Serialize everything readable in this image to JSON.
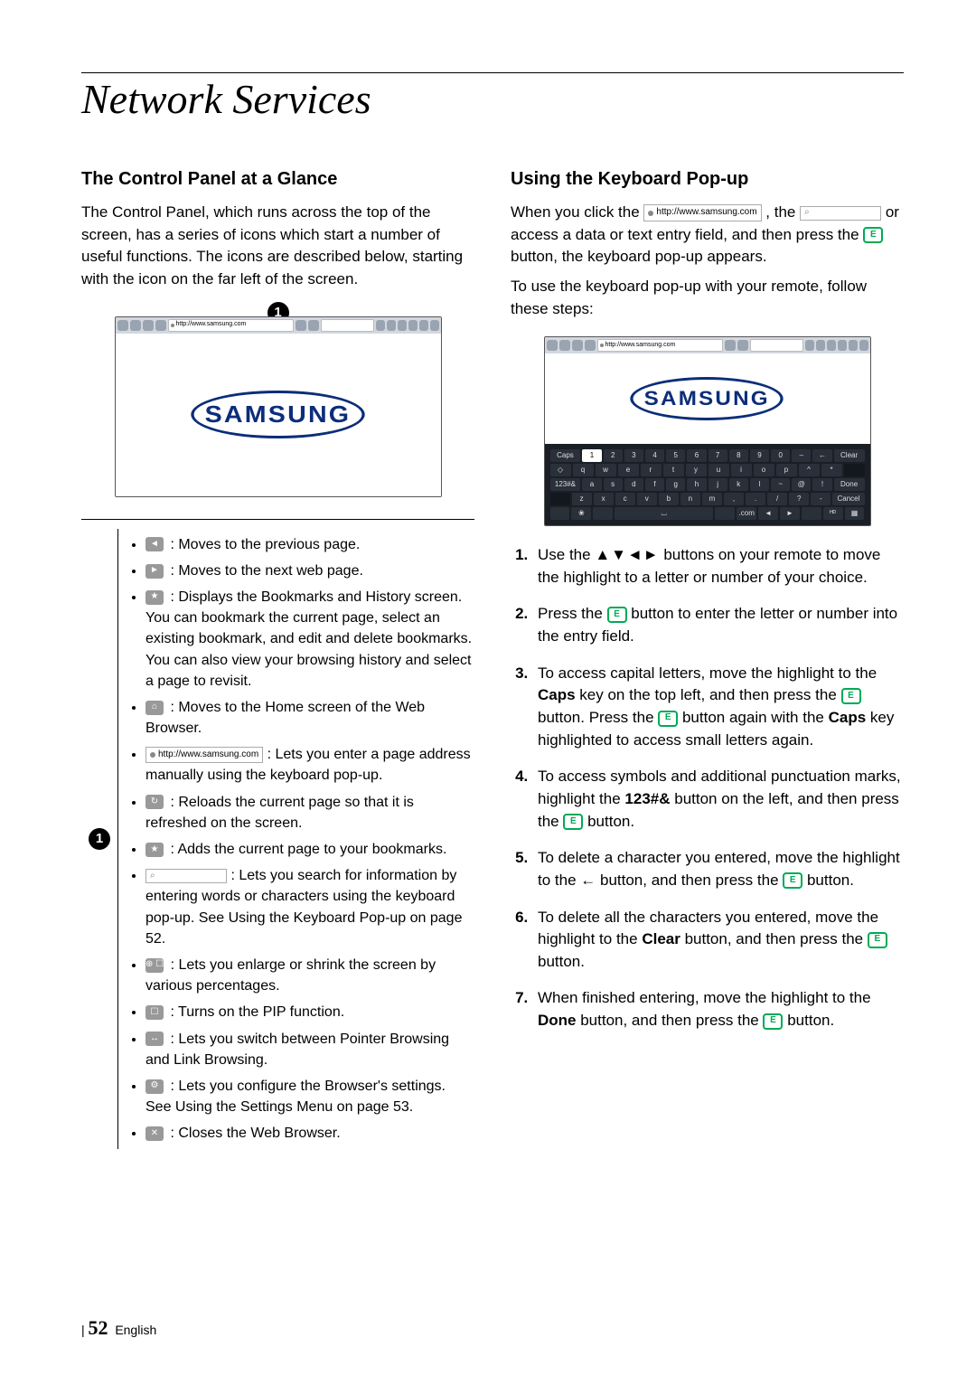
{
  "title": "Network Services",
  "left": {
    "heading": "The Control Panel at a Glance",
    "intro": "The Control Panel, which runs across the top of the screen, has a series of icons which start a number of useful functions. The icons are described below, starting with the icon on the far left of the screen.",
    "figure_url": "http://www.samsung.com",
    "figure_logo": "SAMSUNG",
    "callout_number": "1",
    "items": [
      {
        "icon": "back-icon",
        "glyph": "◄",
        "text": " : Moves to the previous page."
      },
      {
        "icon": "forward-icon",
        "glyph": "►",
        "text": " : Moves to the next web page."
      },
      {
        "icon": "bookmarks-icon",
        "glyph": "★",
        "text": " : Displays the Bookmarks and History screen. You can bookmark the current page, select an existing bookmark, and edit and delete bookmarks. You can also view your browsing history and select a page to revisit."
      },
      {
        "icon": "home-icon",
        "glyph": "⌂",
        "text": " : Moves to the Home screen of the Web Browser."
      },
      {
        "icon": "url-input-icon",
        "url": "http://www.samsung.com",
        "text": " : Lets you enter a page address manually using the keyboard pop-up."
      },
      {
        "icon": "reload-icon",
        "glyph": "↻",
        "text": " : Reloads the current page so that it is refreshed on the screen."
      },
      {
        "icon": "add-bookmark-icon",
        "glyph": "★",
        "text": " : Adds the current page to your bookmarks."
      },
      {
        "icon": "search-input-icon",
        "text": " : Lets you search for information by entering words or characters using the keyboard pop-up. See Using the Keyboard Pop-up on page 52."
      },
      {
        "icon": "zoom-icon",
        "glyph": "⊕ ☐",
        "text": " : Lets you enlarge or shrink the screen by various percentages."
      },
      {
        "icon": "pip-icon",
        "glyph": "☐",
        "text": " : Turns on the PIP function."
      },
      {
        "icon": "browsing-mode-icon",
        "glyph": "↔",
        "text": " : Lets you switch between Pointer Browsing and Link Browsing."
      },
      {
        "icon": "settings-icon",
        "glyph": "⚙",
        "text": " : Lets you configure the Browser's settings. See Using the Settings Menu on page 53."
      },
      {
        "icon": "close-icon",
        "glyph": "✕",
        "text": " : Closes the Web Browser."
      }
    ]
  },
  "right": {
    "heading": "Using the Keyboard Pop-up",
    "intro_pre": "When you click the ",
    "intro_url": "http://www.samsung.com",
    "intro_mid": " , the ",
    "intro_search": "",
    "intro_post": " or access a data or text entry field, and then press the ",
    "intro_tail": " button, the keyboard pop-up appears.",
    "intro2": "To use the keyboard pop-up with your remote, follow these steps:",
    "figure_url": "http://www.samsung.com",
    "figure_logo": "SAMSUNG",
    "keyboard": {
      "row1": [
        "Caps",
        "1",
        "2",
        "3",
        "4",
        "5",
        "6",
        "7",
        "8",
        "9",
        "0",
        "–",
        "←",
        "Clear"
      ],
      "row2": [
        "◇",
        "q",
        "w",
        "e",
        "r",
        "t",
        "y",
        "u",
        "i",
        "o",
        "p",
        "^",
        "*",
        ""
      ],
      "row3": [
        "123#&",
        "a",
        "s",
        "d",
        "f",
        "g",
        "h",
        "j",
        "k",
        "l",
        "~",
        "@",
        "!",
        "Done"
      ],
      "row4": [
        "",
        "z",
        "x",
        "c",
        "v",
        "b",
        "n",
        "m",
        ",",
        ".",
        "/",
        "?",
        "-",
        "Cancel"
      ],
      "row5": [
        "",
        "❀",
        "",
        "⌴",
        "",
        ".com",
        "◄",
        "►",
        "",
        "ᴴᴰ",
        "▦"
      ]
    },
    "steps": [
      {
        "text_pre": "Use the ",
        "arrows": "▲▼◄►",
        "text_post": " buttons on your remote to move the highlight to a letter or number of your choice."
      },
      {
        "text_pre": "Press the ",
        "enter": true,
        "text_post": " button to enter the letter or number into the entry field."
      },
      {
        "text": "To access capital letters, move the highlight to the ",
        "bold1": "Caps",
        "mid1": " key on the top left, and then press the ",
        "enter1": true,
        "mid2": " button. Press the ",
        "enter2": true,
        "mid3": " button again with the ",
        "bold2": "Caps",
        "tail": " key highlighted to access small letters again."
      },
      {
        "text": "To access symbols and additional punctuation marks, highlight the ",
        "bold1": "123#&",
        "mid1": " button on the left, and then press the ",
        "enter1": true,
        "tail": " button."
      },
      {
        "text": "To delete a character you entered, move the highlight to the ",
        "bold1": "←",
        "mid1": " button, and then press the ",
        "enter1": true,
        "tail": " button."
      },
      {
        "text": "To delete all the characters you entered, move the highlight to the ",
        "bold1": "Clear",
        "mid1": " button, and then press the ",
        "enter1": true,
        "tail": " button."
      },
      {
        "text": "When finished entering, move the highlight to the ",
        "bold1": "Done",
        "mid1": " button, and then press the ",
        "enter1": true,
        "tail": " button."
      }
    ]
  },
  "footer": {
    "page": "52",
    "lang": "English"
  }
}
